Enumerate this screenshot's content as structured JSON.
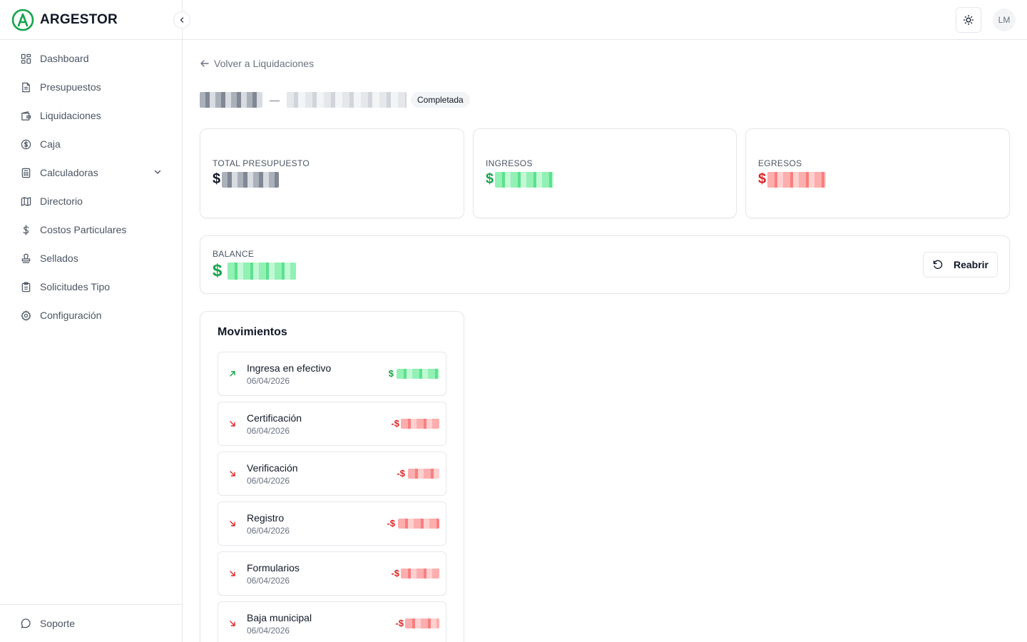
{
  "brand": {
    "name": "ARGESTOR"
  },
  "colors": {
    "accent": "#16a34a",
    "income": "#16a34a",
    "expense": "#dc2626",
    "border": "#e5e7eb"
  },
  "sidebar": {
    "items": [
      {
        "label": "Dashboard",
        "icon": "dashboard-icon"
      },
      {
        "label": "Presupuestos",
        "icon": "file-text-icon"
      },
      {
        "label": "Liquidaciones",
        "icon": "wallet-icon"
      },
      {
        "label": "Caja",
        "icon": "dollar-circle-icon"
      },
      {
        "label": "Calculadoras",
        "icon": "calculator-icon",
        "expandable": true
      },
      {
        "label": "Directorio",
        "icon": "map-icon"
      },
      {
        "label": "Costos Particulares",
        "icon": "dollar-icon"
      },
      {
        "label": "Sellados",
        "icon": "stamp-icon"
      },
      {
        "label": "Solicitudes Tipo",
        "icon": "clipboard-icon"
      },
      {
        "label": "Configuración",
        "icon": "gear-icon"
      }
    ],
    "support_label": "Soporte"
  },
  "topbar": {
    "avatar_initials": "LM"
  },
  "page": {
    "back_label": "Volver a Liquidaciones",
    "separator": "—",
    "status": "Completada"
  },
  "stats": {
    "total": {
      "label": "TOTAL PRESUPUESTO",
      "currency": "$"
    },
    "income": {
      "label": "INGRESOS",
      "currency": "$"
    },
    "expense": {
      "label": "EGRESOS",
      "currency": "$"
    }
  },
  "balance": {
    "label": "BALANCE",
    "currency": "$",
    "reopen_label": "Reabrir"
  },
  "movements": {
    "title": "Movimientos",
    "items": [
      {
        "name": "Ingresa en efectivo",
        "date": "06/04/2026",
        "type": "income",
        "prefix": "$"
      },
      {
        "name": "Certificación",
        "date": "06/04/2026",
        "type": "expense",
        "prefix": "-$"
      },
      {
        "name": "Verificación",
        "date": "06/04/2026",
        "type": "expense",
        "prefix": "-$"
      },
      {
        "name": "Registro",
        "date": "06/04/2026",
        "type": "expense",
        "prefix": "-$"
      },
      {
        "name": "Formularios",
        "date": "06/04/2026",
        "type": "expense",
        "prefix": "-$"
      },
      {
        "name": "Baja municipal",
        "date": "06/04/2026",
        "type": "expense",
        "prefix": "-$"
      }
    ]
  }
}
